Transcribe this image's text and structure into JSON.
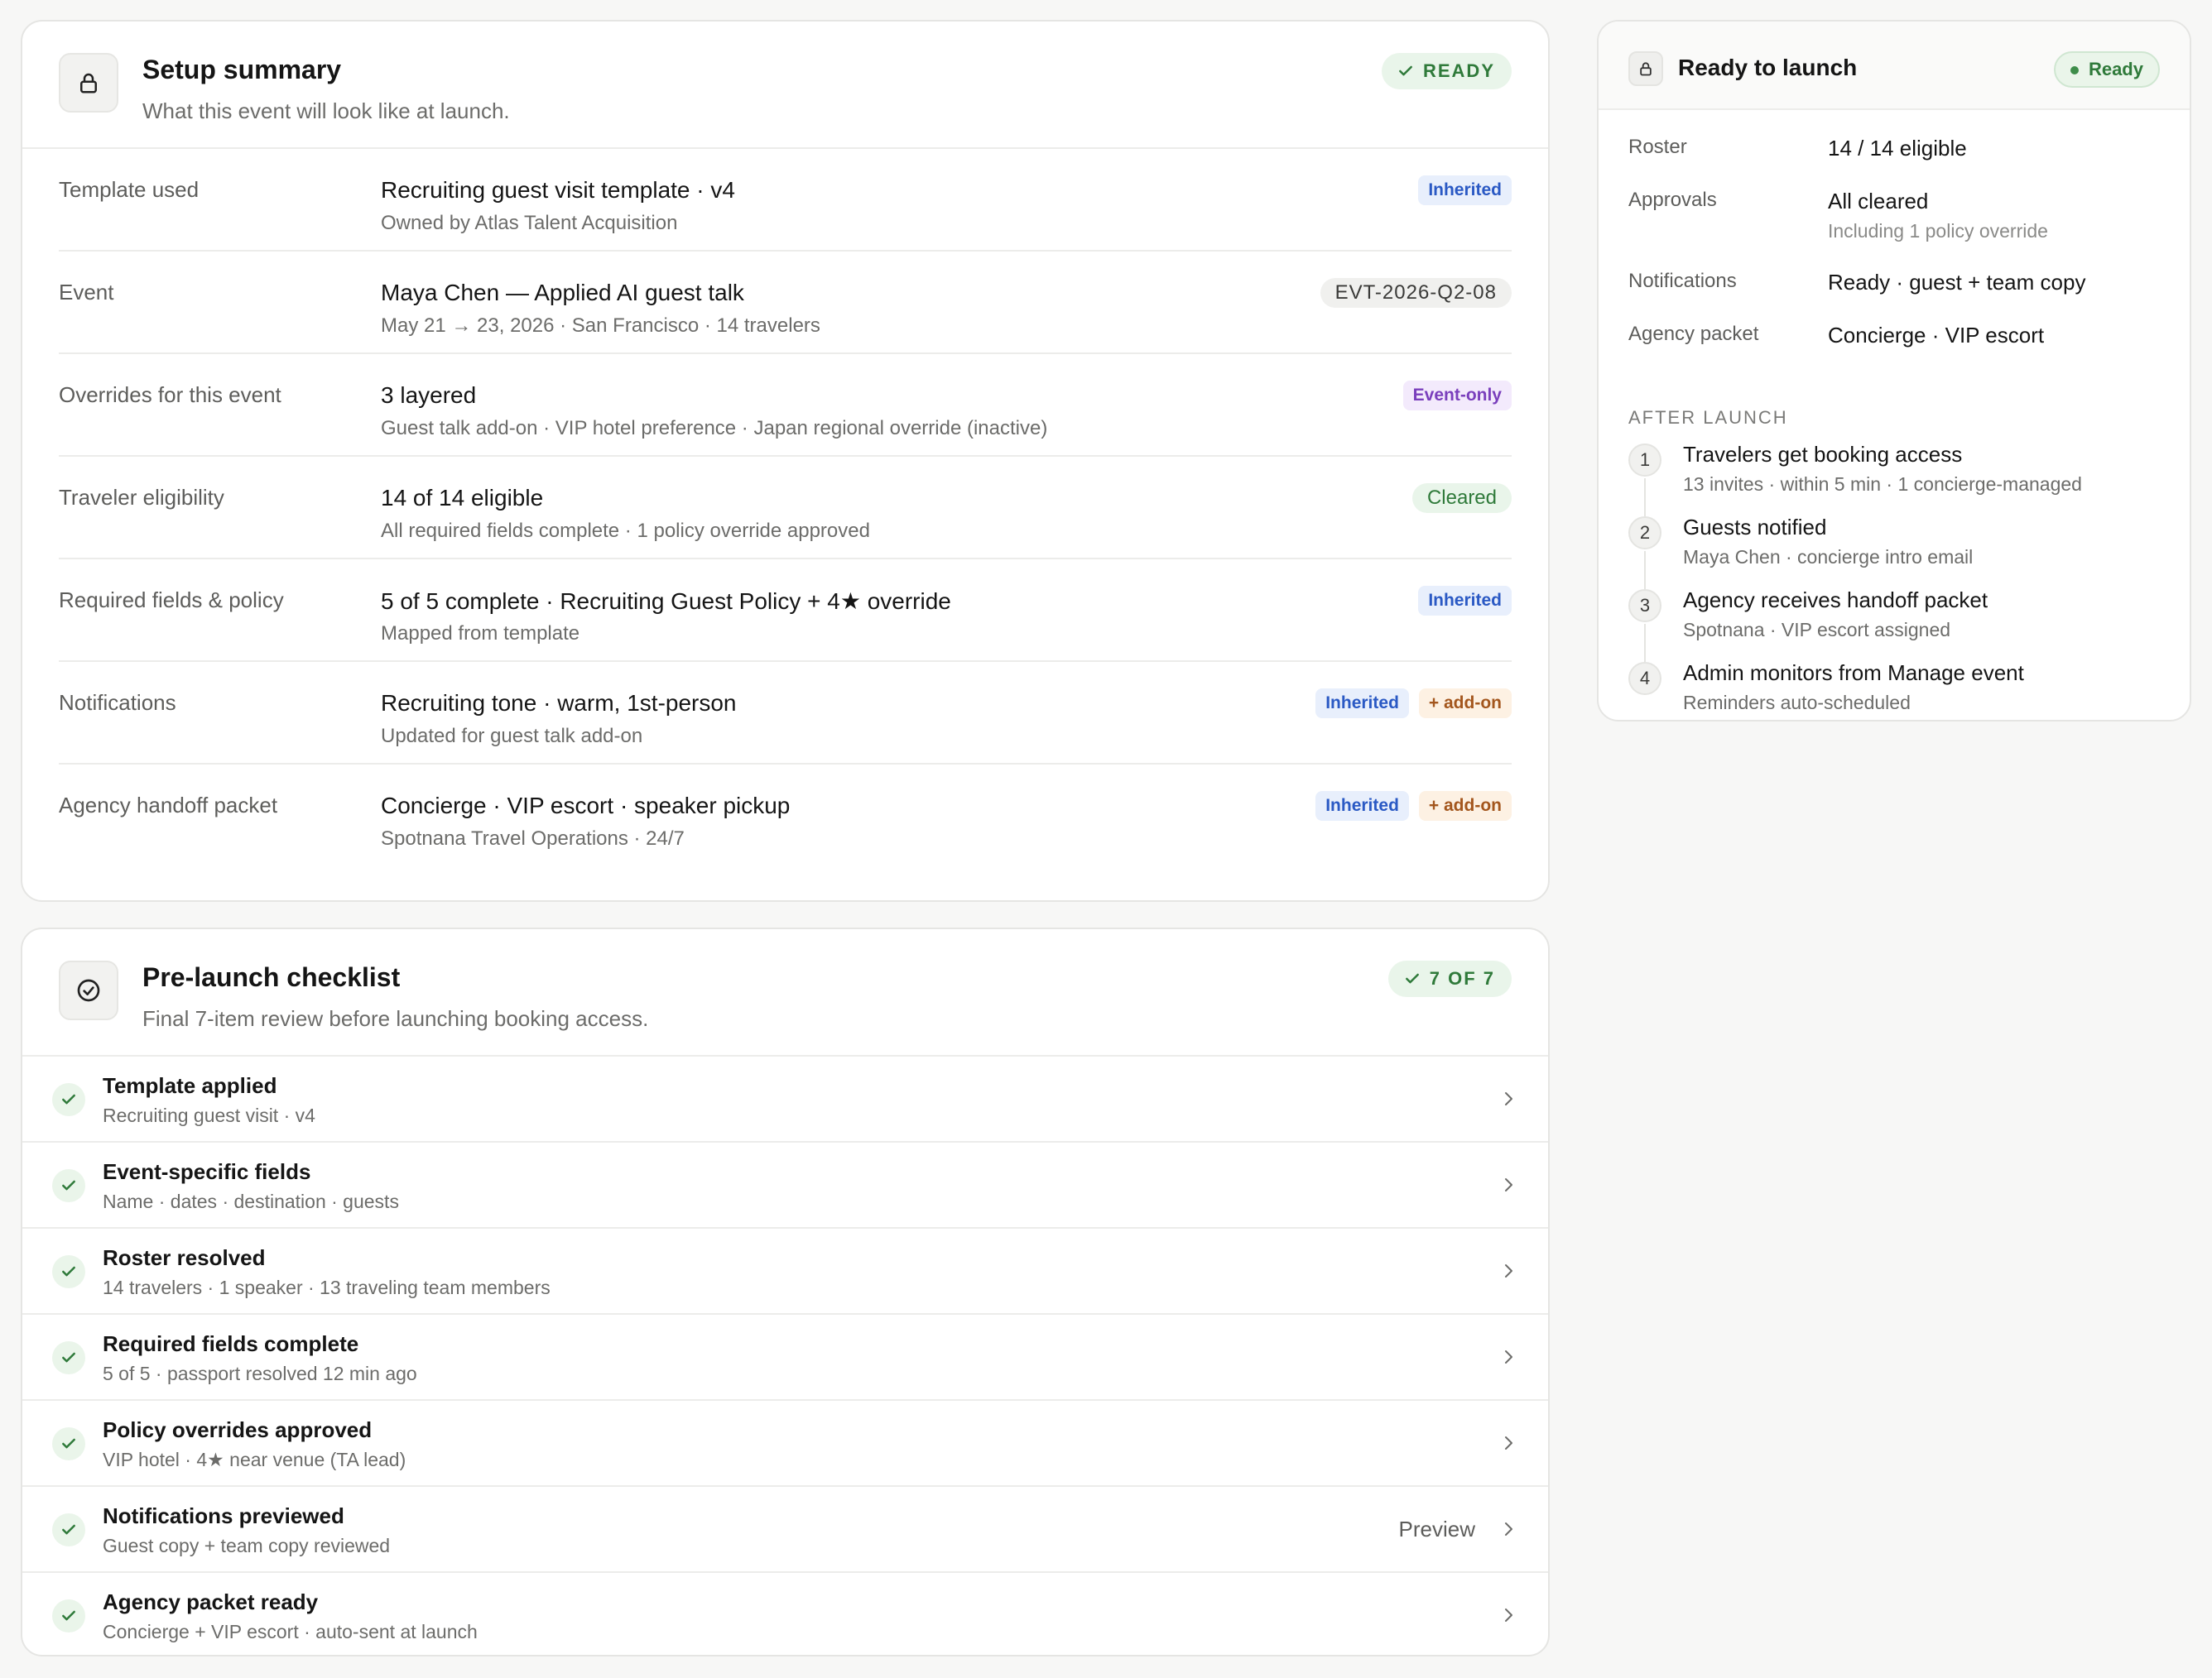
{
  "setup": {
    "title": "Setup summary",
    "subtitle": "What this event will look like at launch.",
    "status": "READY",
    "rows": [
      {
        "label": "Template used",
        "value": "Recruiting guest visit template · v4",
        "sub": "Owned by Atlas Talent Acquisition",
        "tags": [
          "Inherited"
        ]
      },
      {
        "label": "Event",
        "value": "Maya Chen — Applied AI guest talk",
        "sub": "May 21 → 23, 2026 · San Francisco · 14 travelers",
        "tags": [
          "EVT-2026-Q2-08"
        ]
      },
      {
        "label": "Overrides for this event",
        "value": "3 layered",
        "sub": "Guest talk add-on · VIP hotel preference · Japan regional override (inactive)",
        "tags": [
          "Event-only"
        ]
      },
      {
        "label": "Traveler eligibility",
        "value": "14 of 14 eligible",
        "sub": "All required fields complete · 1 policy override approved",
        "tags": [
          "Cleared"
        ]
      },
      {
        "label": "Required fields & policy",
        "value": "5 of 5 complete · Recruiting Guest Policy + 4★ override",
        "sub": "Mapped from template",
        "tags": [
          "Inherited"
        ]
      },
      {
        "label": "Notifications",
        "value": "Recruiting tone · warm, 1st-person",
        "sub": "Updated for guest talk add-on",
        "tags": [
          "Inherited",
          "+ add-on"
        ]
      },
      {
        "label": "Agency handoff packet",
        "value": "Concierge · VIP escort · speaker pickup",
        "sub": "Spotnana Travel Operations · 24/7",
        "tags": [
          "Inherited",
          "+ add-on"
        ]
      }
    ]
  },
  "checklist": {
    "title": "Pre-launch checklist",
    "subtitle": "Final 7-item review before launching booking access.",
    "status": "7 OF 7",
    "items": [
      {
        "title": "Template applied",
        "sub": "Recruiting guest visit · v4"
      },
      {
        "title": "Event-specific fields",
        "sub": "Name · dates · destination · guests"
      },
      {
        "title": "Roster resolved",
        "sub": "14 travelers · 1 speaker · 13 traveling team members"
      },
      {
        "title": "Required fields complete",
        "sub": "5 of 5 · passport resolved 12 min ago"
      },
      {
        "title": "Policy overrides approved",
        "sub": "VIP hotel · 4★ near venue (TA lead)"
      },
      {
        "title": "Notifications previewed",
        "sub": "Guest copy + team copy reviewed",
        "action": "Preview"
      },
      {
        "title": "Agency packet ready",
        "sub": "Concierge + VIP escort · auto-sent at launch"
      }
    ]
  },
  "launch": {
    "title": "Ready to launch",
    "status": "Ready",
    "roster_label": "Roster",
    "roster_value": "14 / 14 eligible",
    "approvals_label": "Approvals",
    "approvals_value": "All cleared",
    "approvals_sub": "Including 1 policy override",
    "notifications_label": "Notifications",
    "notifications_value": "Ready · guest + team copy",
    "agency_label": "Agency packet",
    "agency_value": "Concierge · VIP escort",
    "after_label": "AFTER LAUNCH",
    "steps": [
      {
        "num": "1",
        "title": "Travelers get booking access",
        "sub": "13 invites · within 5 min · 1 concierge-managed"
      },
      {
        "num": "2",
        "title": "Guests notified",
        "sub": "Maya Chen · concierge intro email"
      },
      {
        "num": "3",
        "title": "Agency receives handoff packet",
        "sub": "Spotnana · VIP escort assigned"
      },
      {
        "num": "4",
        "title": "Admin monitors from Manage event",
        "sub": "Reminders auto-scheduled"
      }
    ]
  },
  "icons": {
    "setup": "lock-icon",
    "checklist": "check-circle-icon",
    "launch": "lock-icon",
    "item": "check-icon",
    "chevron": "chevron-right-icon"
  },
  "colors": {
    "ready_green": "#2f7a3a",
    "ready_bg": "#e9f5ea",
    "inherited_blue": "#2a59c4",
    "addon_orange": "#a3561d",
    "eventonly_purple": "#7a3fbc"
  }
}
